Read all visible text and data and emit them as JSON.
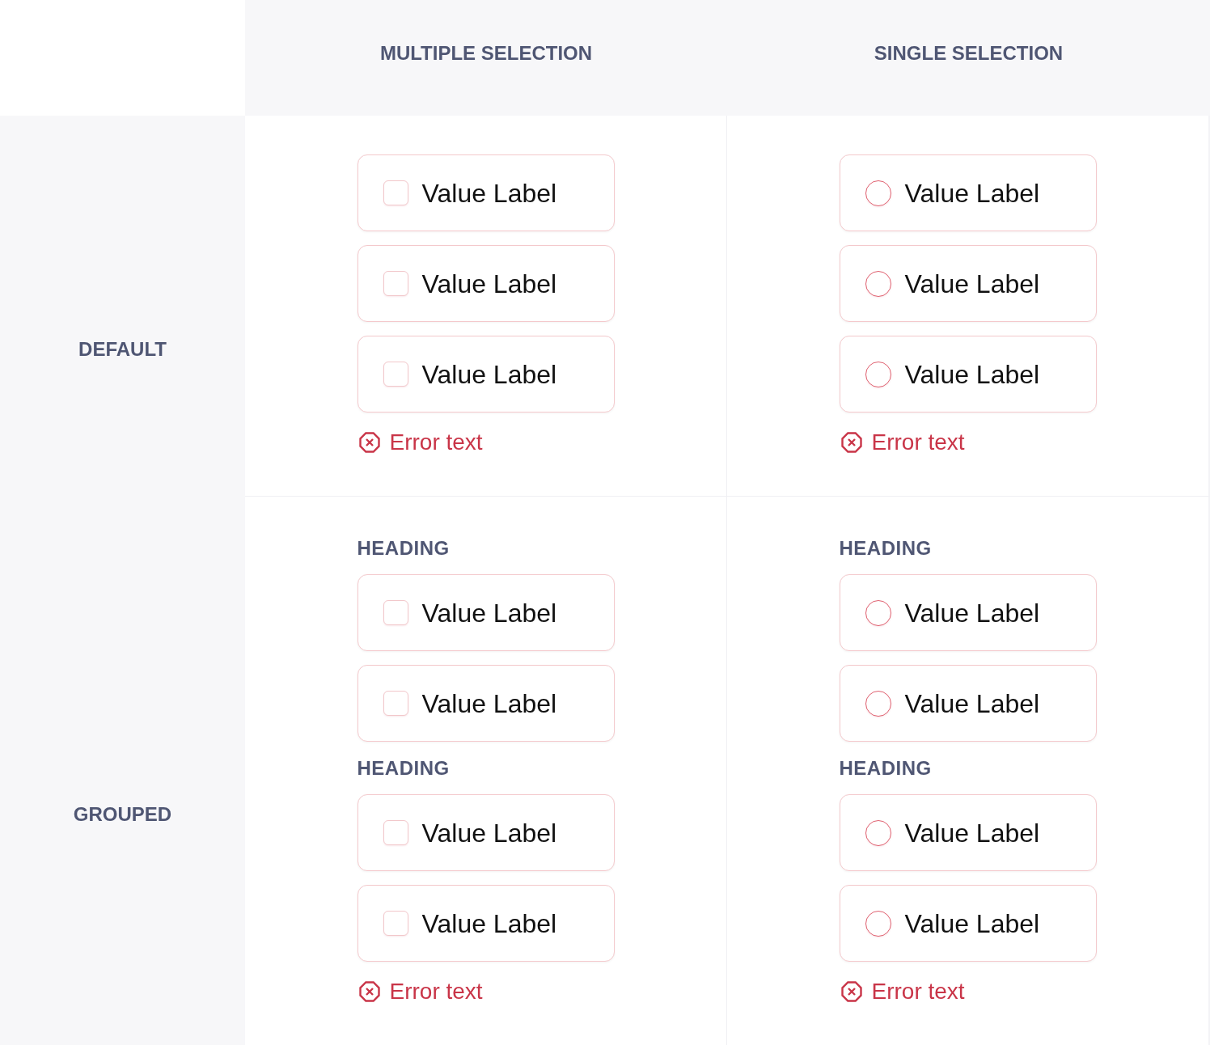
{
  "columns": [
    {
      "title": "MULTIPLE SELECTION"
    },
    {
      "title": "SINGLE SELECTION"
    }
  ],
  "rows": [
    {
      "label": "DEFAULT",
      "cells": [
        {
          "kind": "checkbox",
          "groups": [
            {
              "options": [
                {
                  "label": "Value Label",
                  "checked": false
                },
                {
                  "label": "Value Label",
                  "checked": false
                },
                {
                  "label": "Value Label",
                  "checked": false
                }
              ]
            }
          ],
          "error": "Error text"
        },
        {
          "kind": "radio",
          "groups": [
            {
              "options": [
                {
                  "label": "Value Label",
                  "selected": false
                },
                {
                  "label": "Value Label",
                  "selected": false
                },
                {
                  "label": "Value Label",
                  "selected": false
                }
              ]
            }
          ],
          "error": "Error text"
        }
      ]
    },
    {
      "label": "GROUPED",
      "cells": [
        {
          "kind": "checkbox",
          "groups": [
            {
              "heading": "HEADING",
              "options": [
                {
                  "label": "Value Label",
                  "checked": false
                },
                {
                  "label": "Value Label",
                  "checked": false
                }
              ]
            },
            {
              "heading": "HEADING",
              "options": [
                {
                  "label": "Value Label",
                  "checked": false
                },
                {
                  "label": "Value Label",
                  "checked": false
                }
              ]
            }
          ],
          "error": "Error text"
        },
        {
          "kind": "radio",
          "groups": [
            {
              "heading": "HEADING",
              "options": [
                {
                  "label": "Value Label",
                  "selected": false
                },
                {
                  "label": "Value Label",
                  "selected": false
                }
              ]
            },
            {
              "heading": "HEADING",
              "options": [
                {
                  "label": "Value Label",
                  "selected": false
                },
                {
                  "label": "Value Label",
                  "selected": false
                }
              ]
            }
          ],
          "error": "Error text"
        }
      ]
    }
  ]
}
